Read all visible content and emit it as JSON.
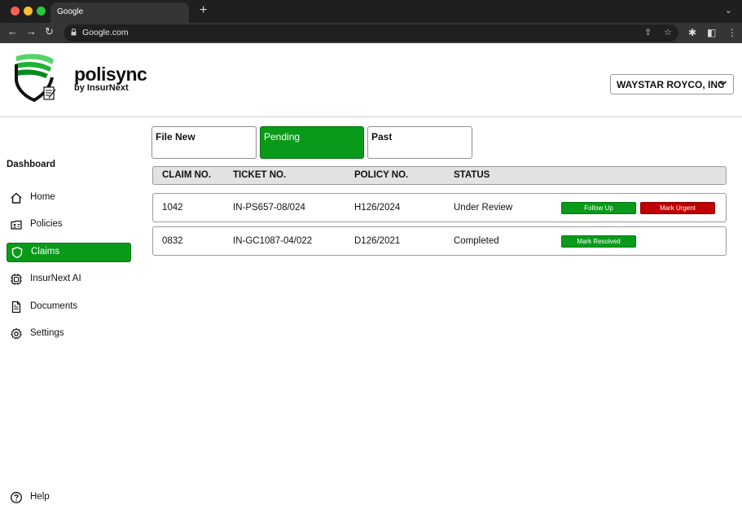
{
  "browser": {
    "tab_title": "Google",
    "new_tab": "+",
    "address": "Google.com"
  },
  "header": {
    "brand_name": "polisync",
    "brand_sub": "by InsurNext",
    "company": "WAYSTAR ROYCO, INC"
  },
  "sidebar": {
    "title": "Dashboard",
    "items": [
      {
        "label": "Home",
        "icon": "home-icon"
      },
      {
        "label": "Policies",
        "icon": "id-card-icon"
      },
      {
        "label": "Claims",
        "icon": "shield-icon"
      },
      {
        "label": "InsurNext AI",
        "icon": "chip-icon"
      },
      {
        "label": "Documents",
        "icon": "document-icon"
      },
      {
        "label": "Settings",
        "icon": "gear-icon"
      }
    ],
    "help_label": "Help"
  },
  "tabs": [
    "File New",
    "Pending",
    "Past"
  ],
  "active_tab": "Pending",
  "table": {
    "columns": [
      "CLAIM NO.",
      "TICKET NO.",
      "POLICY NO.",
      "STATUS"
    ],
    "rows": [
      {
        "claim": "1042",
        "ticket": "IN-PS657-08/024",
        "policy": "H126/2024",
        "status": "Under Review",
        "actions": [
          "Follow Up",
          "Mark Urgent"
        ]
      },
      {
        "claim": "0832",
        "ticket": "IN-GC1087-04/022",
        "policy": "D126/2021",
        "status": "Completed",
        "actions": [
          "Mark Resolved"
        ]
      }
    ]
  },
  "colors": {
    "accent_green": "#0a9a1a",
    "urgent_red": "#c00000"
  }
}
